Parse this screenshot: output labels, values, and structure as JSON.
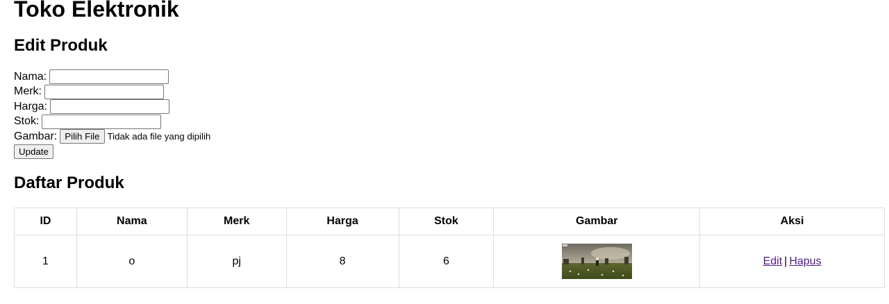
{
  "app": {
    "title": "Toko Elektronik"
  },
  "form": {
    "heading": "Edit Produk",
    "fields": {
      "nama_label": "Nama:",
      "nama_value": "",
      "merk_label": "Merk:",
      "merk_value": "",
      "harga_label": "Harga:",
      "harga_value": "",
      "stok_label": "Stok:",
      "stok_value": "",
      "gambar_label": "Gambar:",
      "file_button": "Pilih File",
      "file_status": "Tidak ada file yang dipilih"
    },
    "submit_label": "Update"
  },
  "list": {
    "heading": "Daftar Produk",
    "columns": [
      "ID",
      "Nama",
      "Merk",
      "Harga",
      "Stok",
      "Gambar",
      "Aksi"
    ],
    "rows": [
      {
        "id": "1",
        "nama": "o",
        "merk": "pj",
        "harga": "8",
        "stok": "6",
        "edit_label": "Edit",
        "separator": "|",
        "delete_label": "Hapus"
      }
    ]
  },
  "colors": {
    "link": "#551a8b",
    "border": "#dddddd",
    "button_bg": "#efefef"
  }
}
